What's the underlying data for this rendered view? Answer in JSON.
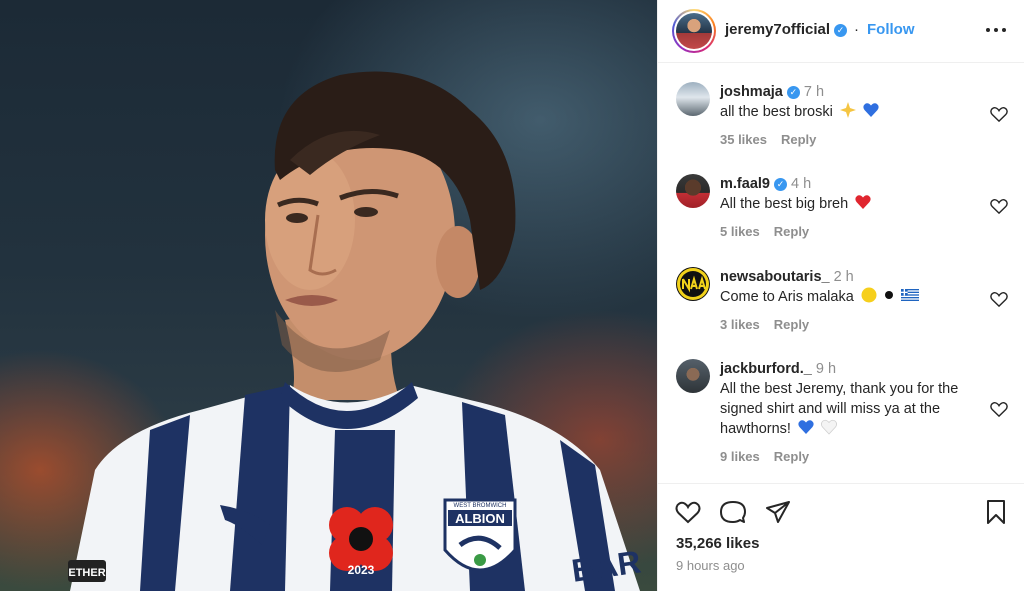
{
  "post": {
    "owner": "jeremy7official",
    "separator": "·",
    "follow_label": "Follow",
    "verified_icon": "verified-badge-icon",
    "likes": "35,266 likes",
    "posted_ago": "9 hours ago"
  },
  "photo": {
    "shirt_sponsor": "BAR",
    "badge_line1": "WEST BROMWICH",
    "badge_line2": "ALBION",
    "poppy_year": "2023",
    "sleeve_text": "ETHER",
    "accent_colors": {
      "navy": "#1e3263",
      "poppy_red": "#e0261d",
      "shirt_white": "#f2f4f7"
    }
  },
  "comments": [
    {
      "user": "joshmaja",
      "verified": true,
      "time": "7 h",
      "text": "all the best broski",
      "emojis": [
        "sparkle-star-emoji",
        "blue-heart-emoji"
      ],
      "likes": "35 likes",
      "reply": "Reply"
    },
    {
      "user": "m.faal9",
      "verified": true,
      "time": "4 h",
      "text": "All the best big breh",
      "emojis": [
        "red-heart-emoji"
      ],
      "likes": "5 likes",
      "reply": "Reply"
    },
    {
      "user": "newsaboutaris_",
      "verified": false,
      "time": "2 h",
      "text": "Come to Aris malaka",
      "emojis": [
        "yellow-circle-emoji",
        "black-circle-emoji",
        "greece-flag-emoji"
      ],
      "likes": "3 likes",
      "reply": "Reply"
    },
    {
      "user": "jackburford._",
      "verified": false,
      "time": "9 h",
      "text": "All the best Jeremy, thank you for the signed shirt and will miss ya at the hawthorns!",
      "emojis": [
        "blue-heart-emoji",
        "white-heart-emoji"
      ],
      "likes": "9 likes",
      "reply": "Reply"
    }
  ],
  "colors": {
    "link_blue": "#3897f0",
    "text": "#262626",
    "muted": "#8e8e8e",
    "divider": "#efefef"
  }
}
